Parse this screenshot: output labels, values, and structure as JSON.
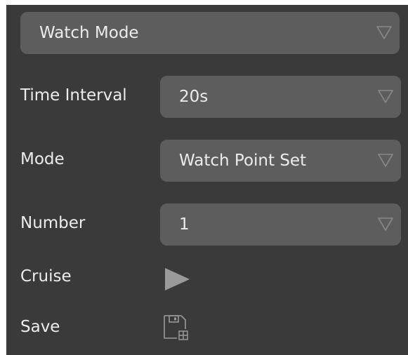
{
  "watch_mode_select": {
    "value": "Watch Mode",
    "icon": "chevron-down-icon"
  },
  "rows": {
    "time_interval": {
      "label": "Time Interval",
      "value": "20s"
    },
    "mode": {
      "label": "Mode",
      "value": "Watch Point Set"
    },
    "number": {
      "label": "Number",
      "value": "1"
    },
    "cruise": {
      "label": "Cruise",
      "icon": "play-icon"
    },
    "save": {
      "label": "Save",
      "icon": "save-icon"
    }
  },
  "colors": {
    "panel_bg": "#3a3a3a",
    "select_bg": "#5d5d5d",
    "text": "#ececec",
    "icon": "#9a9a9a"
  }
}
